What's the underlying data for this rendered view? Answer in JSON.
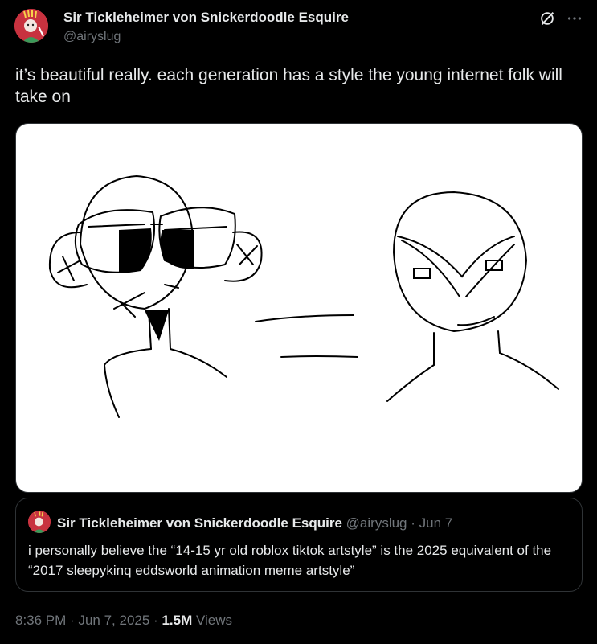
{
  "tweet": {
    "author": {
      "name": "Sir Tickleheimer von Snickerdoodle Esquire",
      "handle": "@airyslug",
      "avatar_icon": "avatar-icon",
      "avatar_color": "#d23a4a"
    },
    "text": "it’s beautiful really. each generation has a style the young internet folk will take on",
    "actions": {
      "grok_icon": "grok-icon",
      "more_icon": "more-icon"
    },
    "quote": {
      "author_name": "Sir Tickleheimer von Snickerdoodle Esquire",
      "handle": "@airyslug",
      "separator": "·",
      "date": "Jun 7",
      "text": "i personally believe the “14-15 yr old roblox tiktok artstyle” is the 2025 equivalent of the “2017 sleepykinq eddsworld animation meme artstyle”"
    },
    "meta": {
      "time": "8:36 PM",
      "separator": "·",
      "date": "Jun 7, 2025",
      "views_count": "1.5M",
      "views_label": "Views"
    }
  },
  "colors": {
    "background": "#000000",
    "text_primary": "#e7e9ea",
    "text_secondary": "#71767b",
    "border": "#2f3336"
  }
}
